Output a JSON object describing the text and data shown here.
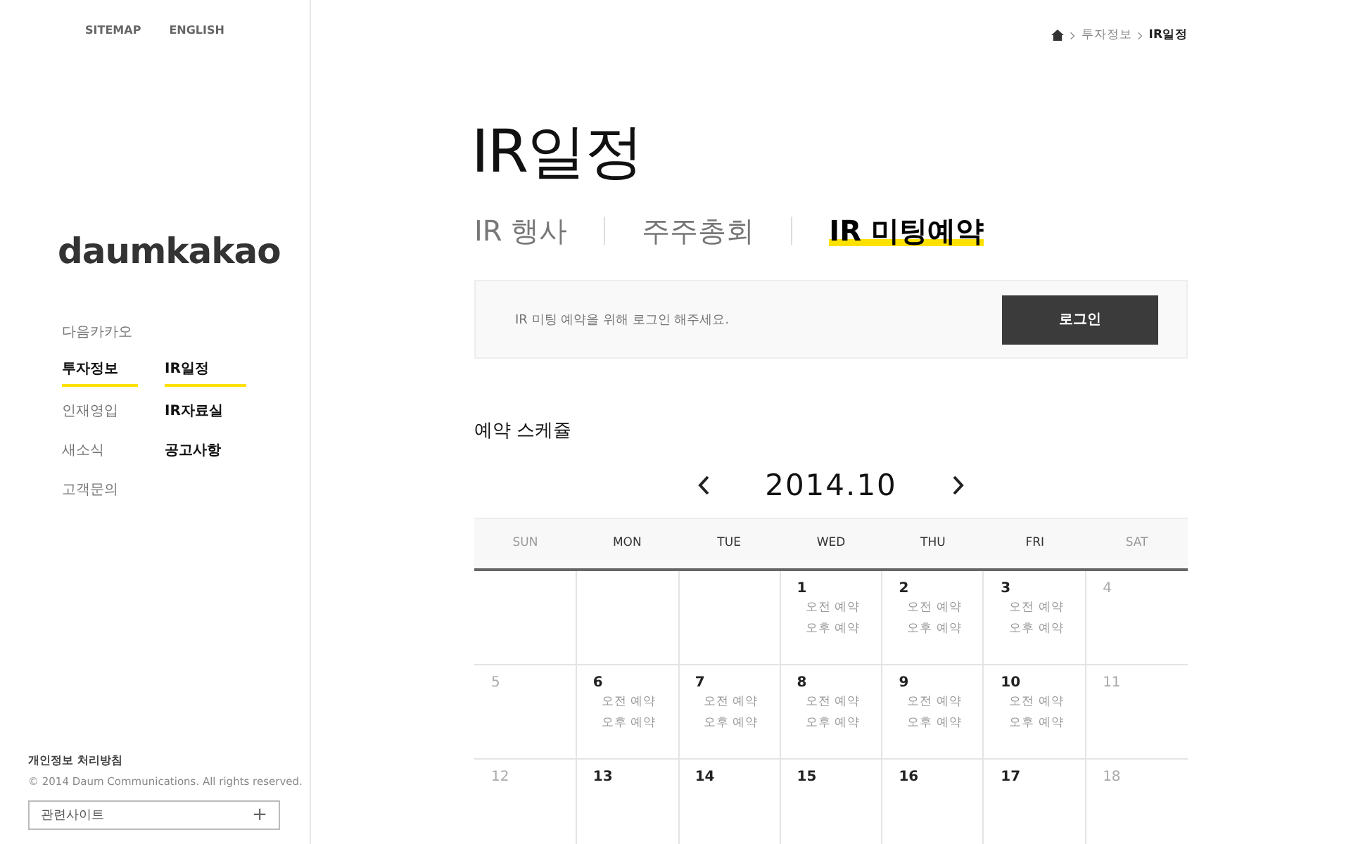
{
  "top_links": [
    "SITEMAP",
    "ENGLISH"
  ],
  "logo": "daumkakao",
  "nav": [
    {
      "label": "다음카카오",
      "selected": false
    },
    {
      "label": "투자정보",
      "selected": true,
      "children": [
        {
          "label": "IR일정",
          "selected": true
        },
        {
          "label": "IR자료실",
          "selected": false
        },
        {
          "label": "공고사항",
          "selected": false
        }
      ]
    },
    {
      "label": "인재영입",
      "selected": false
    },
    {
      "label": "새소식",
      "selected": false
    },
    {
      "label": "고객문의",
      "selected": false
    }
  ],
  "footer": {
    "privacy_link": "개인정보 처리방침",
    "copyright": "© 2014 Daum Communications. All rights reserved.",
    "related_sites": {
      "label": "관련사이트",
      "icon": "+"
    }
  },
  "breadcrumb": [
    "투자정보",
    "IR일정"
  ],
  "page_title": "IR일정",
  "tabs": [
    {
      "label": "IR 행사",
      "selected": false
    },
    {
      "label": "주주총회",
      "selected": false
    },
    {
      "label": "IR 미팅예약",
      "selected": true
    }
  ],
  "login_notice": {
    "message": "IR 미팅 예약을 위해 로그인 해주세요.",
    "button": "로그인"
  },
  "schedule_title": "예약 스케쥴",
  "calendar": {
    "month": "2014.10",
    "columns": [
      {
        "label": "SUN",
        "weekend": true
      },
      {
        "label": "MON",
        "weekend": false
      },
      {
        "label": "TUE",
        "weekend": false
      },
      {
        "label": "WED",
        "weekend": false
      },
      {
        "label": "THU",
        "weekend": false
      },
      {
        "label": "FRI",
        "weekend": false
      },
      {
        "label": "SAT",
        "weekend": true
      }
    ],
    "weeks": [
      [
        {
          "kind": "empty"
        },
        {
          "kind": "empty"
        },
        {
          "kind": "empty"
        },
        {
          "kind": "open",
          "day": "1",
          "slots": [
            "오전 예약",
            "오후 예약"
          ]
        },
        {
          "kind": "open",
          "day": "2",
          "slots": [
            "오전 예약",
            "오후 예약"
          ]
        },
        {
          "kind": "open",
          "day": "3",
          "slots": [
            "오전 예약",
            "오후 예약"
          ]
        },
        {
          "kind": "closed",
          "day": "4"
        }
      ],
      [
        {
          "kind": "closed",
          "day": "5"
        },
        {
          "kind": "open",
          "day": "6",
          "slots": [
            "오전 예약",
            "오후 예약"
          ]
        },
        {
          "kind": "open",
          "day": "7",
          "slots": [
            "오전 예약",
            "오후 예약"
          ]
        },
        {
          "kind": "open",
          "day": "8",
          "slots": [
            "오전 예약",
            "오후 예약"
          ]
        },
        {
          "kind": "open",
          "day": "9",
          "slots": [
            "오전 예약",
            "오후 예약"
          ]
        },
        {
          "kind": "open",
          "day": "10",
          "slots": [
            "오전 예약",
            "오후 예약"
          ]
        },
        {
          "kind": "closed",
          "day": "11"
        }
      ],
      [
        {
          "kind": "closed",
          "day": "12"
        },
        {
          "kind": "open",
          "day": "13"
        },
        {
          "kind": "open",
          "day": "14"
        },
        {
          "kind": "open",
          "day": "15"
        },
        {
          "kind": "open",
          "day": "16"
        },
        {
          "kind": "open",
          "day": "17"
        },
        {
          "kind": "closed",
          "day": "18"
        }
      ]
    ]
  }
}
